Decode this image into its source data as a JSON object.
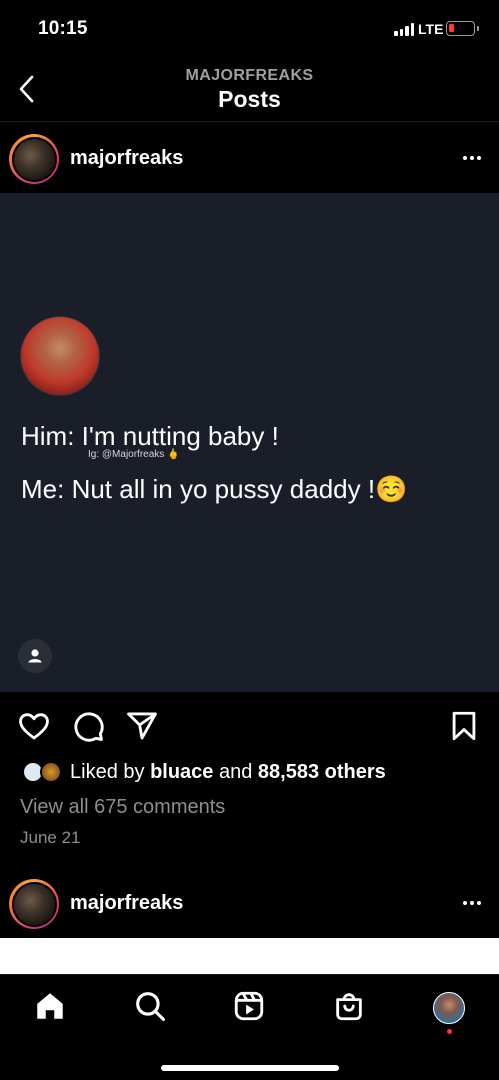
{
  "status": {
    "time": "10:15",
    "network": "LTE"
  },
  "nav": {
    "supertitle": "MAJORFREAKS",
    "title": "Posts"
  },
  "post": {
    "username": "majorfreaks",
    "tweet_line1": "Him: I'm nutting baby !",
    "watermark": "Ig: @Majorfreaks 🖕",
    "tweet_line2": "Me: Nut all in yo pussy daddy !☺️",
    "likes_prefix": "Liked by",
    "likes_user": "bluace",
    "likes_and": "and",
    "likes_others": "88,583 others",
    "comments": "View all 675 comments",
    "date": "June 21"
  },
  "next_post": {
    "username": "majorfreaks"
  },
  "icons": {
    "back": "chevron-left-icon",
    "more": "more-horizontal-icon",
    "like": "heart-icon",
    "comment": "comment-icon",
    "share": "paper-plane-icon",
    "save": "bookmark-icon",
    "tag": "person-icon",
    "tabs": [
      "home-icon",
      "search-icon",
      "reels-icon",
      "shop-icon",
      "profile-avatar"
    ]
  },
  "colors": {
    "background": "#000000",
    "post_bg": "#1a1e28",
    "muted": "#8e8e8e",
    "notification": "#ff3040"
  }
}
